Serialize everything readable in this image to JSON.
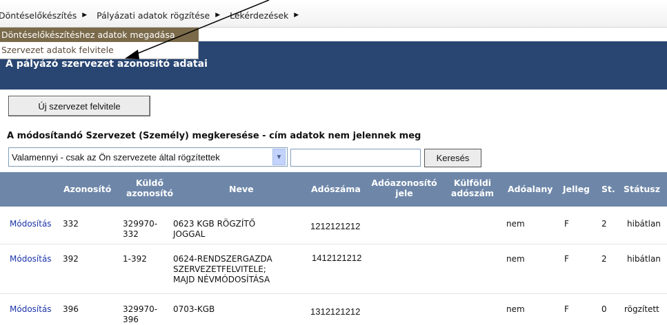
{
  "menu": {
    "items": [
      "Döntéselőkészítés",
      "Pályázati adatok rögzítése",
      "Lekérdezések"
    ]
  },
  "dropdown": {
    "items": [
      "Döntéselőkészítéshez adatok megadása",
      "Szervezet adatok felvitele"
    ]
  },
  "header": {
    "title": "A pályázó szervezet azonosító adatai"
  },
  "new_button": "Új szervezet felvitele",
  "search": {
    "label": "A módosítandó Szervezet (Személy) megkeresése - cím adatok nem jelennek meg",
    "select_value": "Valamennyi - csak az Ön szervezete által rögzítettek",
    "input_value": "",
    "button": "Keresés"
  },
  "table": {
    "headers": {
      "azonosito": "Azonosító",
      "kuldo_1": "Küldő",
      "kuldo_2": "azonosító",
      "neve": "Neve",
      "adoszama": "Adószáma",
      "adoaz_1": "Adóazonosító",
      "adoaz_2": "jele",
      "kulfoldi_1": "Külföldi",
      "kulfoldi_2": "adószám",
      "adoalany": "Adóalany",
      "jelleg": "Jelleg",
      "st": "St.",
      "statusz": "Státusz"
    },
    "rows": [
      {
        "action": "Módosítás",
        "id": "332",
        "kuldo_1": "329970-",
        "kuldo_2": "332",
        "neve_1": "0623 KGB RÖGZÍTŐ",
        "neve_2": "JOGGAL",
        "neve_3": "",
        "tax": "1212121212",
        "adoalany": "nem",
        "jelleg": "F",
        "st": "2",
        "statusz": "hibátlan"
      },
      {
        "action": "Módosítás",
        "id": "392",
        "kuldo_1": "1-392",
        "kuldo_2": "",
        "neve_1": "0624-RENDSZERGAZDA",
        "neve_2": "SZERVEZETFELVITELE;",
        "neve_3": "MAJD NÉVMÓDOSÍTÁSA",
        "tax": "1412121212",
        "adoalany": "nem",
        "jelleg": "F",
        "st": "2",
        "statusz": "hibátlan"
      },
      {
        "action": "Módosítás",
        "id": "396",
        "kuldo_1": "329970-",
        "kuldo_2": "396",
        "neve_1": "0703-KGB",
        "neve_2": "",
        "neve_3": "",
        "tax": "1312121212",
        "adoalany": "nem",
        "jelleg": "F",
        "st": "0",
        "statusz": "rögzített"
      }
    ]
  },
  "colors": {
    "header_bg": "#294673",
    "table_header_bg": "#6e87a9",
    "link": "#1a33a8",
    "dropdown_highlight": "#7a6a4a"
  }
}
